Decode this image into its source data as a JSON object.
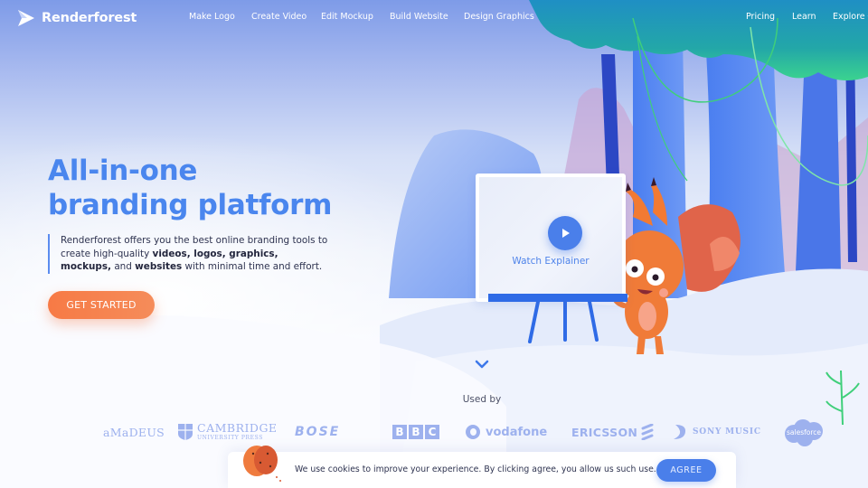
{
  "brand": {
    "name": "Renderforest",
    "accent": "#4a86ee",
    "cta_color": "#f77a45"
  },
  "nav": {
    "items": [
      {
        "label": "Make Logo"
      },
      {
        "label": "Create Video"
      },
      {
        "label": "Edit Mockup"
      },
      {
        "label": "Build Website"
      },
      {
        "label": "Design Graphics"
      }
    ],
    "right_items": [
      {
        "label": "Pricing"
      },
      {
        "label": "Learn"
      },
      {
        "label": "Explore",
        "has_dropdown": true
      }
    ],
    "caret_icon": "▾"
  },
  "hero": {
    "title_line1": "All-in-one",
    "title_line2": "branding platform",
    "description": {
      "part1": "Renderforest offers you the best online branding tools to create high-quality ",
      "bold1": "videos, logos, graphics, mockups,",
      "part2": " and ",
      "bold2": "websites",
      "part3": " with minimal time and effort."
    },
    "cta_label": "GET STARTED",
    "video": {
      "label": "Watch Explainer",
      "icon": "play-icon"
    },
    "scroll_icon": "chevron-down-icon"
  },
  "used_by": {
    "label": "Used by",
    "logos": [
      {
        "name": "amadeus",
        "text": "aMaDEUS"
      },
      {
        "name": "cambridge",
        "text": "CAMBRIDGE",
        "subtext": "UNIVERSITY PRESS"
      },
      {
        "name": "bose",
        "text": "BOSE"
      },
      {
        "name": "bbc",
        "letters": [
          "B",
          "B",
          "C"
        ]
      },
      {
        "name": "vodafone",
        "text": "vodafone"
      },
      {
        "name": "ericsson",
        "text": "ERICSSON"
      },
      {
        "name": "sony-music",
        "text": "SONY MUSIC"
      },
      {
        "name": "salesforce",
        "text": "salesforce"
      }
    ]
  },
  "cookie": {
    "message": "We use cookies to improve your experience. By clicking agree, you allow us such use.",
    "agree_label": "AGREE"
  }
}
